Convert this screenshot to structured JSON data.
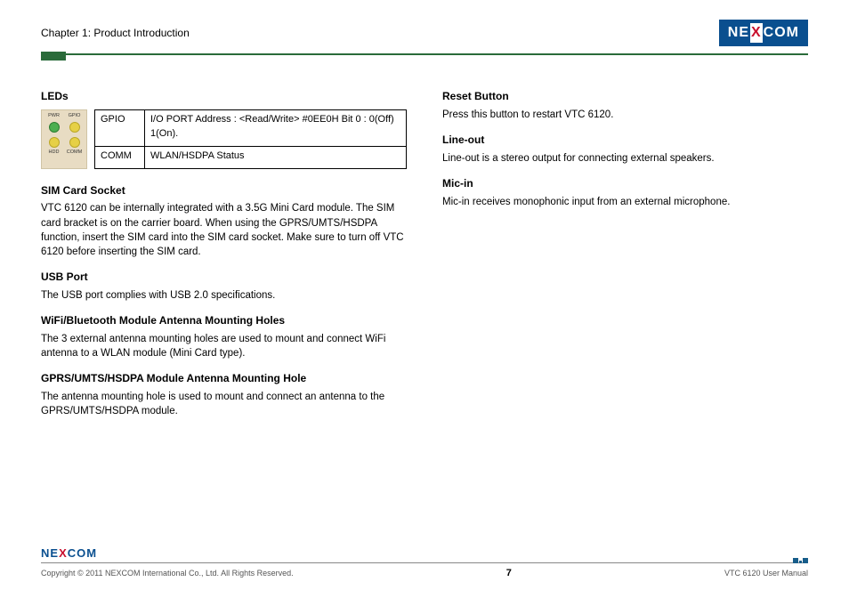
{
  "header": {
    "chapter": "Chapter 1: Product Introduction",
    "brand_parts": {
      "pre": "NE",
      "x": "X",
      "post": "COM"
    }
  },
  "left": {
    "leds": {
      "title": "LEDs",
      "labels": {
        "pwr": "PWR",
        "gpio": "GPIO",
        "hdd": "HDD",
        "comm": "COMM"
      },
      "rows": [
        {
          "name": "GPIO",
          "desc": "I/O PORT Address : <Read/Write>  #0EE0H Bit 0 : 0(Off) 1(On)."
        },
        {
          "name": "COMM",
          "desc": "WLAN/HSDPA Status"
        }
      ]
    },
    "sim": {
      "title": "SIM Card Socket",
      "text": "VTC 6120 can be internally integrated with a 3.5G Mini Card module. The SIM card bracket is on the carrier board. When using the GPRS/UMTS/HSDPA function, insert the SIM card into the SIM card socket. Make sure to turn off VTC 6120 before inserting the SIM card."
    },
    "usb": {
      "title": "USB Port",
      "text": "The USB port complies with USB 2.0 specifications."
    },
    "wifi": {
      "title": "WiFi/Bluetooth Module Antenna Mounting Holes",
      "text": "The 3 external antenna mounting holes are used to mount and connect WiFi antenna to a WLAN module (Mini Card type)."
    },
    "gprs": {
      "title": "GPRS/UMTS/HSDPA Module Antenna Mounting Hole",
      "text": "The antenna mounting hole is used to mount and connect an antenna to the GPRS/UMTS/HSDPA module."
    }
  },
  "right": {
    "reset": {
      "title": "Reset Button",
      "text": "Press this button to restart VTC 6120."
    },
    "lineout": {
      "title": "Line-out",
      "text": "Line-out is a stereo output for connecting external speakers."
    },
    "micin": {
      "title": "Mic-in",
      "text": "Mic-in receives monophonic input from an external microphone."
    }
  },
  "footer": {
    "copyright": "Copyright © 2011 NEXCOM International Co., Ltd. All Rights Reserved.",
    "page": "7",
    "manual": "VTC 6120 User Manual",
    "brand_parts": {
      "pre": "NE",
      "x": "X",
      "post": "COM"
    }
  }
}
